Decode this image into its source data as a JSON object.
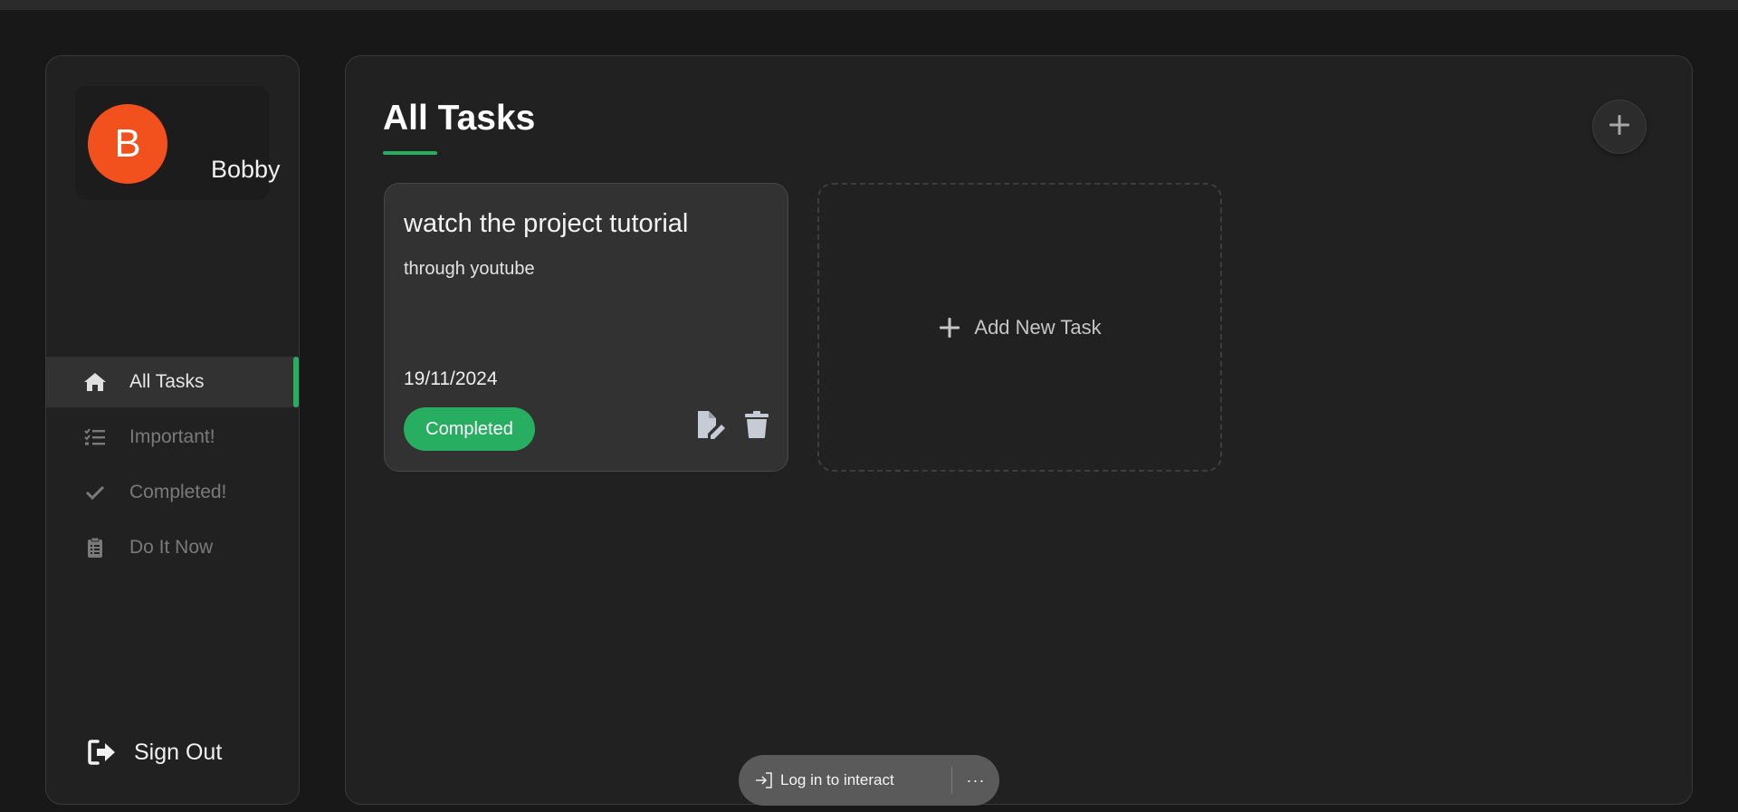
{
  "user": {
    "avatar_initial": "B",
    "name": "Bobby"
  },
  "sidebar": {
    "items": [
      {
        "label": "All Tasks",
        "icon": "home-icon",
        "active": true
      },
      {
        "label": "Important!",
        "icon": "checklist-icon",
        "active": false
      },
      {
        "label": "Completed!",
        "icon": "check-icon",
        "active": false
      },
      {
        "label": "Do It Now",
        "icon": "clipboard-icon",
        "active": false
      }
    ],
    "sign_out_label": "Sign Out"
  },
  "main": {
    "title": "All Tasks",
    "add_button_icon": "plus-icon",
    "tasks": [
      {
        "title": "watch the project tutorial",
        "description": "through youtube",
        "date": "19/11/2024",
        "status": "Completed"
      }
    ],
    "add_new_task_label": "Add New Task"
  },
  "overlay": {
    "login_label": "Log in to interact",
    "more_label": "···"
  },
  "colors": {
    "accent": "#27ae60",
    "avatar": "#f2501c",
    "background": "#181818",
    "panel": "#212121"
  }
}
